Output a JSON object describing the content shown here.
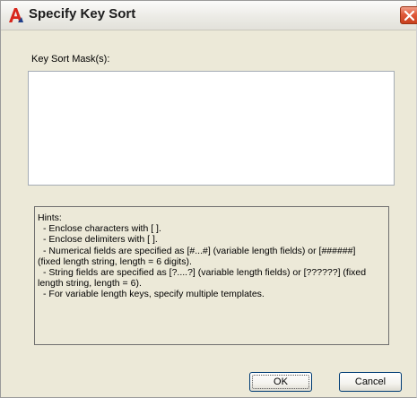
{
  "window": {
    "title": "Specify Key Sort",
    "app_icon": "autocad-a-icon",
    "close_icon": "close-x-icon"
  },
  "key_sort": {
    "label": "Key Sort Mask(s):",
    "value": ""
  },
  "hints": {
    "lines": [
      "Hints:",
      "- Enclose characters with [ ].",
      "- Enclose delimiters with [ ].",
      "- Numerical fields are specified as [#...#] (variable length fields) or [######]",
      "(fixed length string, length = 6 digits).",
      "- String fields are specified as [?....?] (variable length fields) or  [??????] (fixed",
      "length string, length = 6).",
      "- For variable length keys, specify multiple templates."
    ]
  },
  "buttons": {
    "ok": "OK",
    "cancel": "Cancel"
  },
  "colors": {
    "dialog_bg": "#ece9d8",
    "close_button": "#e0593a",
    "icon_red": "#d8261c"
  }
}
